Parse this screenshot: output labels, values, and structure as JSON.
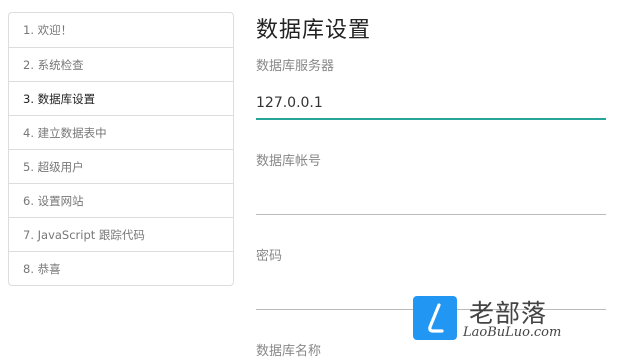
{
  "sidebar": {
    "steps": [
      {
        "label": "1. 欢迎！"
      },
      {
        "label": "2. 系统检查"
      },
      {
        "label": "3. 数据库设置"
      },
      {
        "label": "4. 建立数据表中"
      },
      {
        "label": "5. 超级用户"
      },
      {
        "label": "6. 设置网站"
      },
      {
        "label": "7. JavaScript 跟踪代码"
      },
      {
        "label": "8. 恭喜"
      }
    ]
  },
  "main": {
    "title": "数据库设置",
    "fields": [
      {
        "label": "数据库服务器",
        "value": "127.0.0.1"
      },
      {
        "label": "数据库帐号",
        "value": ""
      },
      {
        "label": "密码",
        "value": ""
      },
      {
        "label": "数据库名称",
        "value": ""
      }
    ]
  },
  "watermark": {
    "brand_cn": "老部落",
    "brand_en": "LaoBuLuo.com"
  },
  "colors": {
    "focus_underline": "#26a69a",
    "watermark_blue": "#2196f3"
  }
}
